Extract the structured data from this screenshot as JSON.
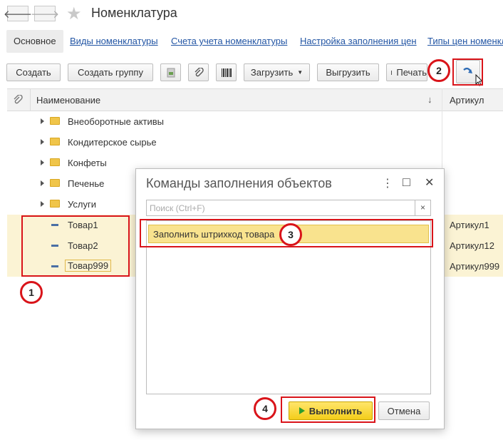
{
  "header": {
    "title": "Номенклатура"
  },
  "tabs": [
    {
      "label": "Основное"
    },
    {
      "label": "Виды номенклатуры"
    },
    {
      "label": "Счета учета номенклатуры"
    },
    {
      "label": "Настройка заполнения цен"
    },
    {
      "label": "Типы цен номенклатуры"
    }
  ],
  "toolbar": {
    "create": "Создать",
    "create_group": "Создать группу",
    "load": "Загрузить",
    "unload": "Выгрузить",
    "print": "Печать"
  },
  "table": {
    "col_name": "Наименование",
    "col_sort": "↓",
    "col_article": "Артикул",
    "groups": [
      {
        "name": "Внеоборотные активы"
      },
      {
        "name": "Кондитерское сырье"
      },
      {
        "name": "Конфеты"
      },
      {
        "name": "Печенье"
      },
      {
        "name": "Услуги"
      }
    ],
    "items": [
      {
        "name": "Товар1",
        "article": "Артикул1"
      },
      {
        "name": "Товар2",
        "article": "Артикул12"
      },
      {
        "name": "Товар999",
        "article": "Артикул999"
      }
    ]
  },
  "dialog": {
    "title": "Команды заполнения объектов",
    "search_placeholder": "Поиск (Ctrl+F)",
    "clear": "×",
    "command": "Заполнить штрихкод товара",
    "run": "Выполнить",
    "cancel": "Отмена",
    "menu_glyph": "⋮",
    "maximize_glyph": "□",
    "close_glyph": "✕"
  },
  "annotations": [
    "1",
    "2",
    "3",
    "4"
  ],
  "colors": {
    "annotation_red": "#d9141a",
    "selected_row": "#fbf3d4",
    "run_button": "#f4ce1a",
    "link": "#2255a4"
  }
}
